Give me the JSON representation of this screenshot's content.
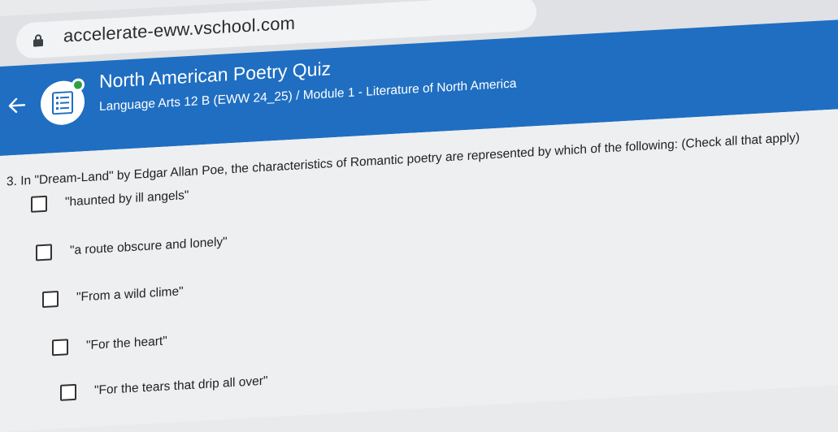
{
  "browser": {
    "url": "accelerate-eww.vschool.com",
    "lock_icon": "lock-icon"
  },
  "header": {
    "back_icon": "arrow-left-icon",
    "quiz_icon": "quiz-list-icon",
    "title": "North American Poetry Quiz",
    "subtitle": "Language Arts 12 B (EWW 24_25) / Module 1 - Literature of North America",
    "accent_color": "#1f6ec2"
  },
  "question": {
    "text": "3. In \"Dream-Land\" by Edgar Allan Poe, the characteristics of Romantic poetry are represented by which of the following: (Check all that apply)",
    "options": [
      {
        "label": "\"haunted by ill angels\"",
        "checked": false
      },
      {
        "label": "\"a route obscure and lonely\"",
        "checked": false
      },
      {
        "label": "\"From a wild clime\"",
        "checked": false
      },
      {
        "label": "\"For the heart\"",
        "checked": false
      },
      {
        "label": "\"For the tears that drip all over\"",
        "checked": false
      }
    ]
  }
}
